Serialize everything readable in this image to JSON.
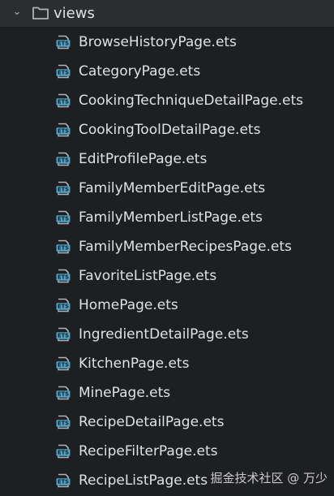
{
  "tree": {
    "folder": {
      "name": "views",
      "expanded": true,
      "icon": "folder-icon"
    },
    "files": [
      {
        "name": "BrowseHistoryPage.ets",
        "icon": "ets-file-icon"
      },
      {
        "name": "CategoryPage.ets",
        "icon": "ets-file-icon"
      },
      {
        "name": "CookingTechniqueDetailPage.ets",
        "icon": "ets-file-icon"
      },
      {
        "name": "CookingToolDetailPage.ets",
        "icon": "ets-file-icon"
      },
      {
        "name": "EditProfilePage.ets",
        "icon": "ets-file-icon"
      },
      {
        "name": "FamilyMemberEditPage.ets",
        "icon": "ets-file-icon"
      },
      {
        "name": "FamilyMemberListPage.ets",
        "icon": "ets-file-icon"
      },
      {
        "name": "FamilyMemberRecipesPage.ets",
        "icon": "ets-file-icon"
      },
      {
        "name": "FavoriteListPage.ets",
        "icon": "ets-file-icon"
      },
      {
        "name": "HomePage.ets",
        "icon": "ets-file-icon"
      },
      {
        "name": "IngredientDetailPage.ets",
        "icon": "ets-file-icon"
      },
      {
        "name": "KitchenPage.ets",
        "icon": "ets-file-icon"
      },
      {
        "name": "MinePage.ets",
        "icon": "ets-file-icon"
      },
      {
        "name": "RecipeDetailPage.ets",
        "icon": "ets-file-icon"
      },
      {
        "name": "RecipeFilterPage.ets",
        "icon": "ets-file-icon"
      },
      {
        "name": "RecipeListPage.ets",
        "icon": "ets-file-icon"
      }
    ]
  },
  "watermark": "掘金技术社区 @ 万少",
  "colors": {
    "background": "#1e1f22",
    "selected_row": "#2b2d30",
    "text": "#dfe1e5",
    "folder_outline": "#aeb1b7",
    "ets_icon_blue": "#4fa3c7"
  }
}
